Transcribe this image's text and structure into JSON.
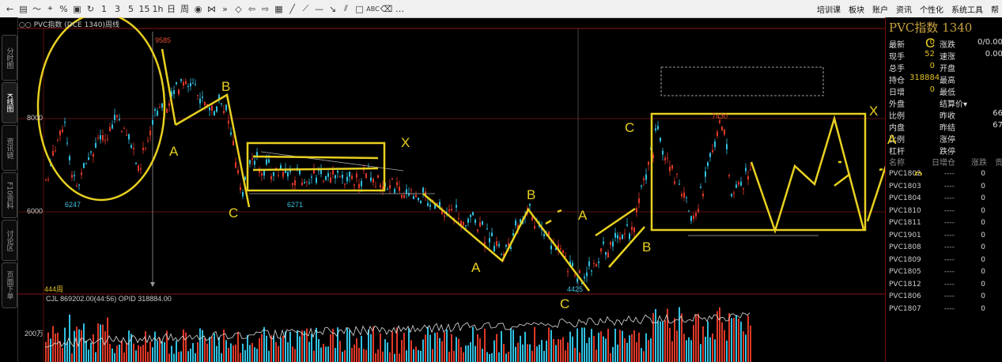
{
  "toolbar": {
    "icons": [
      "back-arrow-icon",
      "table-icon",
      "line-chart-icon",
      "crosshair-icon",
      "percent-icon",
      "save-icon",
      "refresh-icon"
    ],
    "periods": [
      "1",
      "3",
      "5",
      "15",
      "1h",
      "日",
      "周"
    ],
    "right_menu": [
      "培训课",
      "板块",
      "账户",
      "资讯",
      "个性化",
      "系统工具",
      "帮"
    ]
  },
  "left_tabs": [
    "分时图",
    "K线图",
    "资讯链",
    "F10资料",
    "讨论区",
    "页面下单"
  ],
  "chart": {
    "title": "○○ PVC指数 (DCE 1340)周线",
    "y_labels": [
      "8000",
      "6000"
    ],
    "vol_label": "200万",
    "price_marks": [
      "9585",
      "6247",
      "6271",
      "4425",
      "7430"
    ],
    "period_note": "444周",
    "indicator_line": "CJL  869202.00(44:56)   OPID  318884.00",
    "wave_labels": [
      "A",
      "B",
      "C",
      "X",
      "A",
      "B",
      "C",
      "A",
      "B",
      "C",
      "X",
      "A",
      "B",
      "C"
    ]
  },
  "panel": {
    "title": "PVC指数   1340",
    "quote_rows": [
      {
        "l": "最新",
        "v": "0",
        "l2": "涨跌",
        "v2": "0/0.00"
      },
      {
        "l": "现手",
        "v": "52",
        "l2": "速涨",
        "v2": "0.00"
      },
      {
        "l": "总手",
        "v": "0",
        "l2": "开盘",
        "v2": ""
      },
      {
        "l": "持仓",
        "v": "318884",
        "l2": "最高",
        "v2": ""
      },
      {
        "l": "日增",
        "v": "0",
        "l2": "最低",
        "v2": ""
      },
      {
        "l": "外盘",
        "v": "",
        "l2": "结算价▾",
        "v2": ""
      },
      {
        "l": "比例",
        "v": "",
        "l2": "昨收",
        "v2": "66"
      },
      {
        "l": "内盘",
        "v": "",
        "l2": "昨结",
        "v2": "67"
      },
      {
        "l": "比例",
        "v": "",
        "l2": "涨停",
        "v2": ""
      },
      {
        "l": "杠杆",
        "v": "",
        "l2": "跌停",
        "v2": ""
      }
    ],
    "list_headers": [
      "名称",
      "日增仓",
      "涨跌",
      "贡"
    ],
    "contracts": [
      {
        "n": "PVC1802",
        "a": "----",
        "b": "0"
      },
      {
        "n": "PVC1803",
        "a": "----",
        "b": "0"
      },
      {
        "n": "PVC1804",
        "a": "----",
        "b": "0"
      },
      {
        "n": "PVC1810",
        "a": "----",
        "b": "0"
      },
      {
        "n": "PVC1811",
        "a": "----",
        "b": "0"
      },
      {
        "n": "PVC1901",
        "a": "----",
        "b": "0"
      },
      {
        "n": "PVC1808",
        "a": "----",
        "b": "0"
      },
      {
        "n": "PVC1809",
        "a": "----",
        "b": "0"
      },
      {
        "n": "PVC1805",
        "a": "----",
        "b": "0"
      },
      {
        "n": "PVC1812",
        "a": "----",
        "b": "0"
      },
      {
        "n": "PVC1806",
        "a": "----",
        "b": "0"
      },
      {
        "n": "PVC1807",
        "a": "----",
        "b": "0"
      }
    ]
  }
}
